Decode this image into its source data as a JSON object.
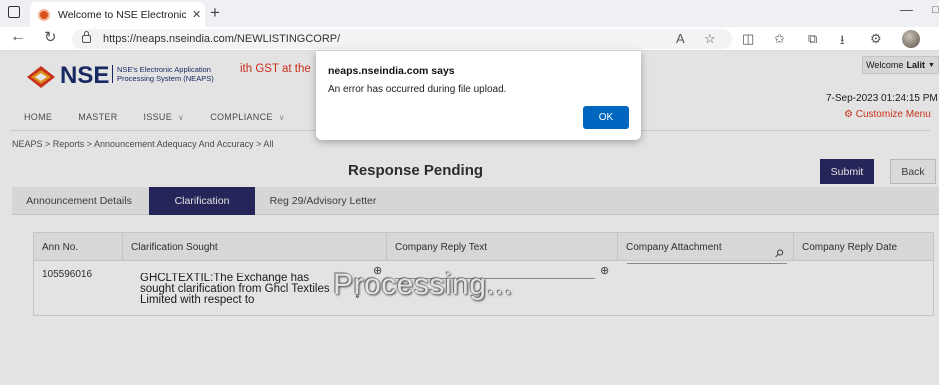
{
  "browser": {
    "tab_title": "Welcome to NSE Electronic Appli",
    "url": "https://neaps.nseindia.com/NEWLISTINGCORP/"
  },
  "header": {
    "logo_text": "NSE",
    "logo_sub_line1": "NSE's Electronic Application",
    "logo_sub_line2": "Processing System (NEAPS)",
    "ticker_text": "ith GST at the",
    "welcome_label": "Welcome",
    "welcome_user": "Lalit",
    "datetime": "7-Sep-2023 01:24:15 PM",
    "customize_menu": "Customize Menu"
  },
  "menu": [
    "HOME",
    "MASTER",
    "ISSUE",
    "COMPLIANCE"
  ],
  "breadcrumb": "NEAPS > Reports > Announcement Adequacy And Accuracy > All",
  "page_title": "Response Pending",
  "buttons": {
    "submit": "Submit",
    "back": "Back"
  },
  "tabs": [
    "Announcement Details",
    "Clarification",
    "Reg 29/Advisory Letter"
  ],
  "table": {
    "headers": [
      "Ann No.",
      "Clarification Sought",
      "Company Reply Text",
      "Company Attachment",
      "Company Reply Date"
    ],
    "row": {
      "ann_no": "105596016",
      "clarification": "GHCLTEXTIL:The Exchange has sought clarification from Ghcl Textiles Limited with respect to"
    }
  },
  "processing_text": "Processing...",
  "dialog": {
    "title": "neaps.nseindia.com says",
    "message": "An error has occurred during file upload.",
    "ok": "OK"
  },
  "colors": {
    "brand_navy": "#2b2a64",
    "accent_red": "#e2361f",
    "dialog_blue": "#0067c0"
  }
}
